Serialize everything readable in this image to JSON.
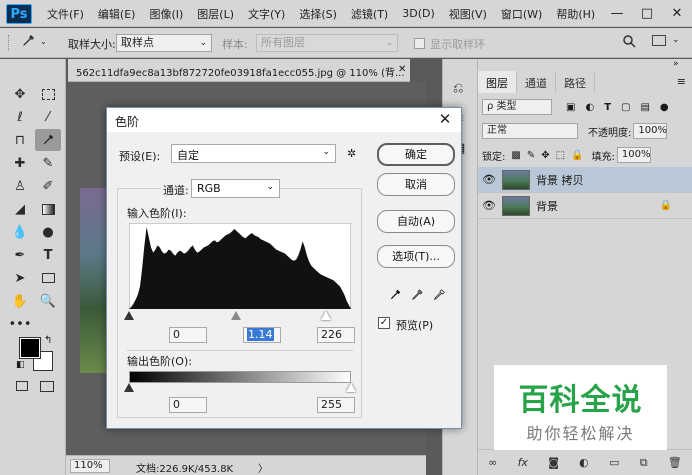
{
  "app": {
    "logo": "Ps"
  },
  "menu": [
    "文件(F)",
    "编辑(E)",
    "图像(I)",
    "图层(L)",
    "文字(Y)",
    "选择(S)",
    "滤镜(T)",
    "3D(D)",
    "视图(V)",
    "窗口(W)",
    "帮助(H)"
  ],
  "window_controls": {
    "minimize": "—",
    "maximize": "□",
    "close": "✕"
  },
  "options": {
    "tool_icon": "eyedropper-icon",
    "sample_size_label": "取样大小:",
    "sample_size_value": "取样点",
    "sample_label": "样本:",
    "sample_value": "所有图层",
    "show_ring_label": "显示取样环"
  },
  "document": {
    "tab_title": "562c11dfa9ec8a13bf872720fe03918fa1ecc055.jpg @ 110% (背...",
    "tab_close": "✕",
    "zoom": "110%",
    "status": "文档:226.9K/453.8K",
    "status_arrow": "〉"
  },
  "layers_panel": {
    "tabs": [
      "图层",
      "通道",
      "路径"
    ],
    "filter_label": "ρ 类型",
    "blend_mode": "正常",
    "opacity_label": "不透明度:",
    "opacity_value": "100%",
    "lock_label": "锁定:",
    "fill_label": "填充:",
    "fill_value": "100%",
    "layers": [
      {
        "name": "背景 拷贝",
        "selected": true
      },
      {
        "name": "背景",
        "locked": true
      }
    ],
    "footer_icons": [
      "link-icon",
      "fx-icon",
      "mask-icon",
      "adjustment-icon",
      "folder-icon",
      "new-layer-icon",
      "trash-icon"
    ]
  },
  "levels_dialog": {
    "title": "色阶",
    "close": "✕",
    "preset_label": "预设(E):",
    "preset_value": "自定",
    "channel_label": "通道:",
    "channel_value": "RGB",
    "input_label": "输入色阶(I):",
    "input_black": "0",
    "input_gamma": "1.14",
    "input_white": "226",
    "output_label": "输出色阶(O):",
    "output_black": "0",
    "output_white": "255",
    "input_sliders": {
      "black": 0,
      "gamma": 1.14,
      "white": 226
    },
    "output_sliders": {
      "black": 0,
      "white": 255
    },
    "histogram": [
      0,
      2,
      5,
      9,
      14,
      22,
      40,
      62,
      80,
      70,
      60,
      55,
      58,
      62,
      60,
      56,
      54,
      55,
      58,
      57,
      54,
      52,
      55,
      57,
      56,
      54,
      55,
      57,
      60,
      62,
      58,
      55,
      56,
      58,
      60,
      61,
      62,
      64,
      66,
      67,
      65,
      66,
      68,
      70,
      72,
      73,
      74,
      76,
      78,
      76,
      74,
      72,
      70,
      69,
      71,
      73,
      74,
      72,
      71,
      70,
      68,
      67,
      66,
      65,
      64,
      62,
      60,
      58,
      57,
      56,
      55,
      54,
      52,
      50,
      48,
      47,
      48,
      52,
      58,
      66,
      60,
      52,
      46,
      42,
      40,
      38,
      36,
      34,
      33,
      32,
      31,
      30,
      29,
      28,
      26,
      24,
      22,
      18,
      14,
      8,
      4,
      0
    ],
    "buttons": {
      "ok": "确定",
      "cancel": "取消",
      "auto": "自动(A)",
      "options": "选项(T)..."
    },
    "preview_label": "预览(P)",
    "preview_checked": true
  },
  "watermark": {
    "title": "百科全说",
    "subtitle": "助你轻松解决",
    "color": "#29a34a"
  }
}
